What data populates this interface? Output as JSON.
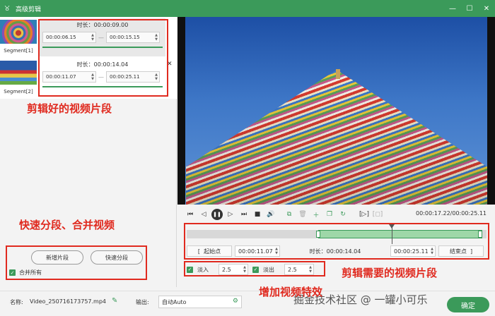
{
  "window": {
    "title": "高级剪辑",
    "logo": "୪",
    "min": "—",
    "max": "☐",
    "close": "✕"
  },
  "segments": [
    {
      "caption": "Segment[1]",
      "duration": "时长：00:00:09.00",
      "start": "00:00:06.15",
      "end": "00:00:15.15"
    },
    {
      "caption": "Segment[2]",
      "duration": "时长：00:00:14.04",
      "start": "00:00:11.07",
      "end": "00:00:25.11"
    }
  ],
  "annotations": {
    "segments": "剪辑好的视频片段",
    "split_merge": "快速分段、合并视频",
    "clip": "剪辑需要的视频片段",
    "effects": "增加视频特效"
  },
  "left_buttons": {
    "add_segment": "新增片段",
    "quick_split": "快速分段",
    "merge_all": "合并所有"
  },
  "player": {
    "time": "00:00:17.22/00:00:25.11"
  },
  "trim": {
    "start_label": "起始点",
    "start_value": "00:00:11.07",
    "duration": "时长：00:00:14.04",
    "end_value": "00:00:25.11",
    "end_label": "结束点"
  },
  "effects": {
    "fade_in_label": "淡入",
    "fade_in_value": "2.5",
    "fade_out_label": "淡出",
    "fade_out_value": "2.5"
  },
  "bottom": {
    "name_label": "名称:",
    "filename": "Video_250716173757.mp4",
    "output_label": "输出:",
    "output_value": "自动Auto",
    "ok": "确定",
    "watermark": "掘金技术社区 @ 一罐小可乐"
  },
  "colors": {
    "accent": "#3b9a5a",
    "annotation": "#e02a1f"
  }
}
